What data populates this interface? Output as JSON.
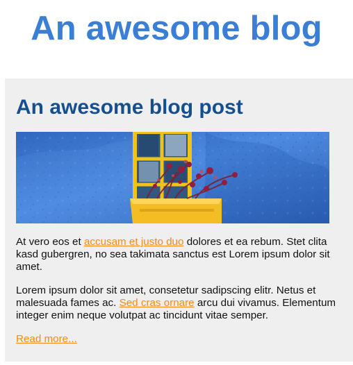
{
  "site": {
    "title": "An awesome blog"
  },
  "post": {
    "title": "An awesome blog post",
    "hero_image": {
      "alt": "Blue wall with yellow window and flower box",
      "colors": {
        "wall": "#3f79c8",
        "window": "#f3c21d",
        "flowers": "#7e1d3a"
      }
    },
    "paragraph_1": {
      "text_before": "At vero eos et ",
      "link_text": "accusam et justo duo",
      "text_after": " dolores et ea rebum. Stet clita kasd gubergren, no sea takimata sanctus est Lorem ipsum dolor sit amet."
    },
    "paragraph_2": {
      "text_before": "Lorem ipsum dolor sit amet, consetetur sadipscing elitr. Netus et malesuada fames ac. ",
      "link_text": "Sed cras ornare",
      "text_after": " arcu dui vivamus. Elementum integer enim neque volutpat ac tincidunt vitae semper."
    },
    "read_more": "Read more..."
  },
  "colors": {
    "site_title": "#3a7fd5",
    "post_title": "#164f8f",
    "link": "#f58a15",
    "card_background": "#efefef"
  }
}
